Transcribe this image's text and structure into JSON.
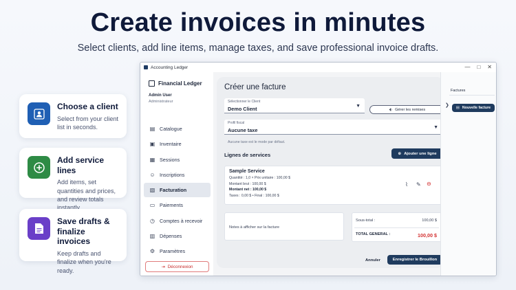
{
  "hero": {
    "title": "Create invoices in minutes",
    "subtitle": "Select clients, add line items, manage taxes, and save professional invoice drafts."
  },
  "features": [
    {
      "title": "Choose a client",
      "text": "Select from your client list in seconds.",
      "icon": "person-icon",
      "color": "#1f5fb4"
    },
    {
      "title": "Add service lines",
      "text": "Add items, set quantities and prices, and review totals instantly.",
      "icon": "plus-circle-icon",
      "color": "#2e8b45"
    },
    {
      "title": "Save drafts & finalize invoices",
      "text": "Keep drafts and finalize when you're ready.",
      "icon": "document-icon",
      "color": "#6a3fc8"
    }
  ],
  "window": {
    "title": "Accounting Ledger",
    "controls": [
      "—",
      "□",
      "✕"
    ]
  },
  "sidebar": {
    "brand": "Financial Ledger",
    "user_name": "Admin User",
    "user_role": "Administrateur",
    "items": [
      {
        "label": "Catalogue",
        "icon": "catalog-icon"
      },
      {
        "label": "Inventaire",
        "icon": "inventory-icon"
      },
      {
        "label": "Sessions",
        "icon": "calendar-icon"
      },
      {
        "label": "Inscriptions",
        "icon": "user-add-icon"
      },
      {
        "label": "Facturation",
        "icon": "invoice-icon",
        "active": true
      },
      {
        "label": "Paiements",
        "icon": "card-icon"
      },
      {
        "label": "Comptes à recevoir",
        "icon": "clock-icon"
      },
      {
        "label": "Dépenses",
        "icon": "receipt-icon"
      },
      {
        "label": "Paramètres",
        "icon": "gear-icon"
      }
    ],
    "logout": "Déconnexion"
  },
  "form": {
    "title": "Créer une facture",
    "client_label": "Sélectionner le Client",
    "client_value": "Demo Client",
    "discounts_button": "Gérer les remises",
    "tax_label": "Profil fiscal",
    "tax_value": "Aucune taxe",
    "tax_hint": "Aucune taxe est le mode par défaut.",
    "lines_title": "Lignes de services",
    "add_line_button": "Ajouter une ligne",
    "service": {
      "name": "Sample Service",
      "detail": "Quantité : 1,0 × Prix unitaire : 100,00 $",
      "gross": "Montant brut : 100,00 $",
      "net": "Montant net : 100,00 $",
      "taxes": "Taxes : 0,00 $ • Final : 100,00 $"
    },
    "notes_placeholder": "Notes à afficher sur la facture",
    "subtotal_label": "Sous-total :",
    "subtotal_value": "100,00 $",
    "total_label": "TOTAL GENERAL :",
    "total_value": "100,00 $",
    "cancel_button": "Annuler",
    "save_button": "Enregistrer le Brouillon"
  },
  "right_panel": {
    "tab": "Factures",
    "new_invoice_button": "Nouvelle facture"
  }
}
